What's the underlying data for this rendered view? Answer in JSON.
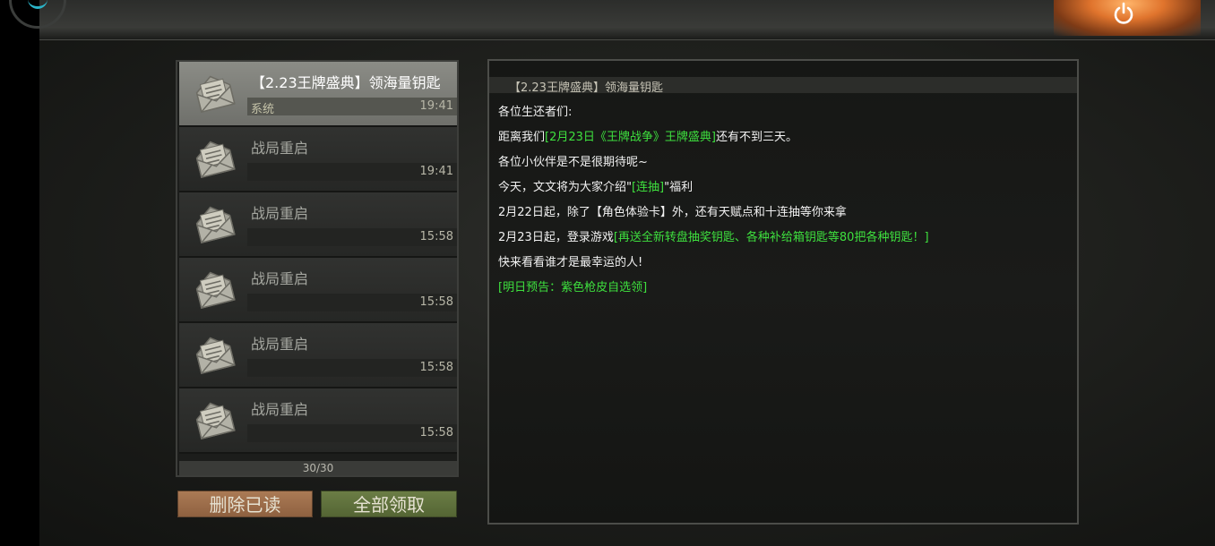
{
  "colors": {
    "highlight_green": "#3ee03e",
    "selected_item_bg": "#8b8c86",
    "delete_button_bg": "#ab7a55",
    "claim_button_bg": "#6b7d45"
  },
  "top_bar": {
    "power_icon": "power-icon",
    "spinner_icon": "loading-spinner-icon"
  },
  "mail_list": {
    "items": [
      {
        "title": "【2.23王牌盛典】领海量钥匙",
        "sender": "系统",
        "time": "19:41",
        "selected": true,
        "icon": "envelope-icon"
      },
      {
        "title": "战局重启",
        "sender": "",
        "time": "19:41",
        "selected": false,
        "icon": "envelope-icon"
      },
      {
        "title": "战局重启",
        "sender": "",
        "time": "15:58",
        "selected": false,
        "icon": "envelope-icon"
      },
      {
        "title": "战局重启",
        "sender": "",
        "time": "15:58",
        "selected": false,
        "icon": "envelope-icon"
      },
      {
        "title": "战局重启",
        "sender": "",
        "time": "15:58",
        "selected": false,
        "icon": "envelope-icon"
      },
      {
        "title": "战局重启",
        "sender": "",
        "time": "15:58",
        "selected": false,
        "icon": "envelope-icon"
      }
    ],
    "count": "30/30"
  },
  "buttons": {
    "delete_read": "删除已读",
    "claim_all": "全部领取"
  },
  "content": {
    "title": "【2.23王牌盛典】领海量钥匙",
    "lines": [
      [
        {
          "t": "各位生还者们:",
          "hl": false
        }
      ],
      [
        {
          "t": "距离我们",
          "hl": false
        },
        {
          "t": "[2月23日《王牌战争》王牌盛典]",
          "hl": true
        },
        {
          "t": "还有不到三天。",
          "hl": false
        }
      ],
      [
        {
          "t": "各位小伙伴是不是很期待呢~",
          "hl": false
        }
      ],
      [
        {
          "t": "今天，文文将为大家介绍\"",
          "hl": false
        },
        {
          "t": "[连抽]",
          "hl": true
        },
        {
          "t": "\"福利",
          "hl": false
        }
      ],
      [
        {
          "t": "2月22日起，除了【角色体验卡】外，还有天赋点和十连抽等你来拿",
          "hl": false
        }
      ],
      [
        {
          "t": "2月23日起，登录游戏",
          "hl": false
        },
        {
          "t": "[再送全新转盘抽奖钥匙、各种补给箱钥匙等80把各种钥匙！]",
          "hl": true
        }
      ],
      [
        {
          "t": "快来看看谁才是最幸运的人!",
          "hl": false
        }
      ],
      [
        {
          "t": "[明日预告：紫色枪皮自选领]",
          "hl": true
        }
      ]
    ]
  }
}
